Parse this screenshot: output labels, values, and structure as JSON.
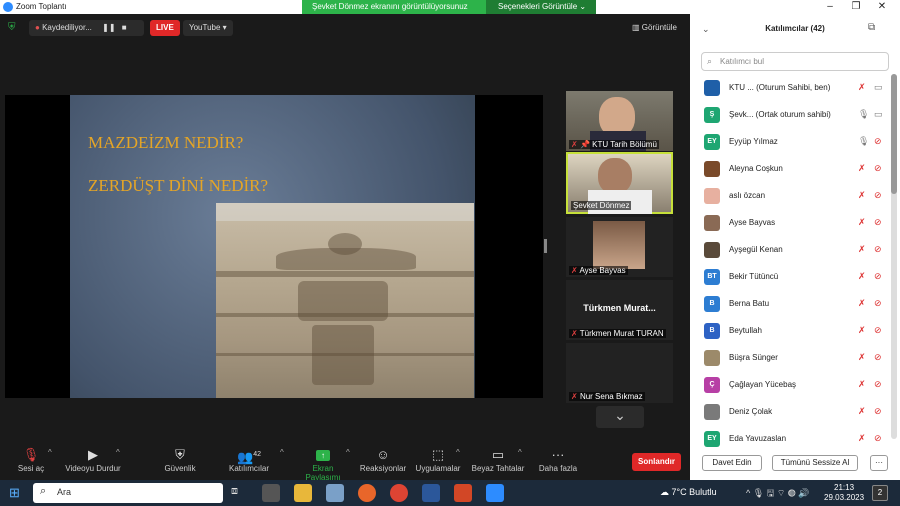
{
  "window": {
    "title": "Zoom Toplantı",
    "minimize": "–",
    "maximize": "❐",
    "close": "✕"
  },
  "share_banner": {
    "message": "Şevket Dönmez ekranını görüntülüyorsunuz",
    "options": "Seçenekleri Görüntüle"
  },
  "top_controls": {
    "recording": "Kaydediliyor...",
    "live": "LIVE",
    "stream": "YouTube",
    "view": "Görüntüle"
  },
  "slide": {
    "line1": "MAZDEİZM NEDİR?",
    "line2": "ZERDÜŞT DİNİ NEDİR?"
  },
  "video_thumbs": [
    {
      "name": "KTU Tarih Bölümü"
    },
    {
      "name": "Şevket Dönmez"
    },
    {
      "name": "Ayse Bayvas"
    },
    {
      "name": "Türkmen Murat TURAN",
      "center_label": "Türkmen Murat..."
    },
    {
      "name": "Nur Sena Bıkmaz"
    }
  ],
  "toolbar": {
    "mute": "Sesi aç",
    "video": "Videoyu Durdur",
    "security": "Güvenlik",
    "participants": "Katılımcılar",
    "participants_count": "42",
    "share": "Ekran Paylaşımı",
    "reactions": "Reaksiyonlar",
    "apps": "Uygulamalar",
    "whiteboards": "Beyaz Tahtalar",
    "more": "Daha fazla",
    "end": "Sonlandır"
  },
  "panel": {
    "title": "Katılımcılar (42)",
    "search_placeholder": "Katılımcı bul",
    "participants": [
      {
        "initials": "",
        "name": "KTU ...   (Oturum Sahibi, ben)",
        "color": "#1f5fa8"
      },
      {
        "initials": "Ş",
        "name": "Şevk...  (Ortak oturum sahibi)",
        "color": "#1ea672"
      },
      {
        "initials": "EY",
        "name": "Eyyüp Yılmaz",
        "color": "#1ea672"
      },
      {
        "initials": "",
        "name": "Aleyna Coşkun",
        "color": "#7a4a2a"
      },
      {
        "initials": "",
        "name": "aslı özcan",
        "color": "#e7b0a0"
      },
      {
        "initials": "",
        "name": "Ayse Bayvas",
        "color": "#8a6a55"
      },
      {
        "initials": "",
        "name": "Ayşegül Kenan",
        "color": "#5a4a3a"
      },
      {
        "initials": "BT",
        "name": "Bekir Tütüncü",
        "color": "#2d7dd2"
      },
      {
        "initials": "B",
        "name": "Berna Batu",
        "color": "#2d7dd2"
      },
      {
        "initials": "B",
        "name": "Beytullah",
        "color": "#2d62c4"
      },
      {
        "initials": "",
        "name": "Büşra Sünger",
        "color": "#9c8a6a"
      },
      {
        "initials": "Ç",
        "name": "Çağlayan Yücebaş",
        "color": "#b73fa5"
      },
      {
        "initials": "",
        "name": "Deniz Çolak",
        "color": "#7a7a7a"
      },
      {
        "initials": "EY",
        "name": "Eda Yavuzaslan",
        "color": "#1ea672"
      }
    ],
    "invite": "Davet Edin",
    "mute_all": "Tümünü Sessize Al",
    "more": "···"
  },
  "taskbar": {
    "search": "Ara",
    "weather": "7°C  Bulutlu",
    "time": "21:13",
    "date": "29.03.2023",
    "notifications": "2"
  }
}
